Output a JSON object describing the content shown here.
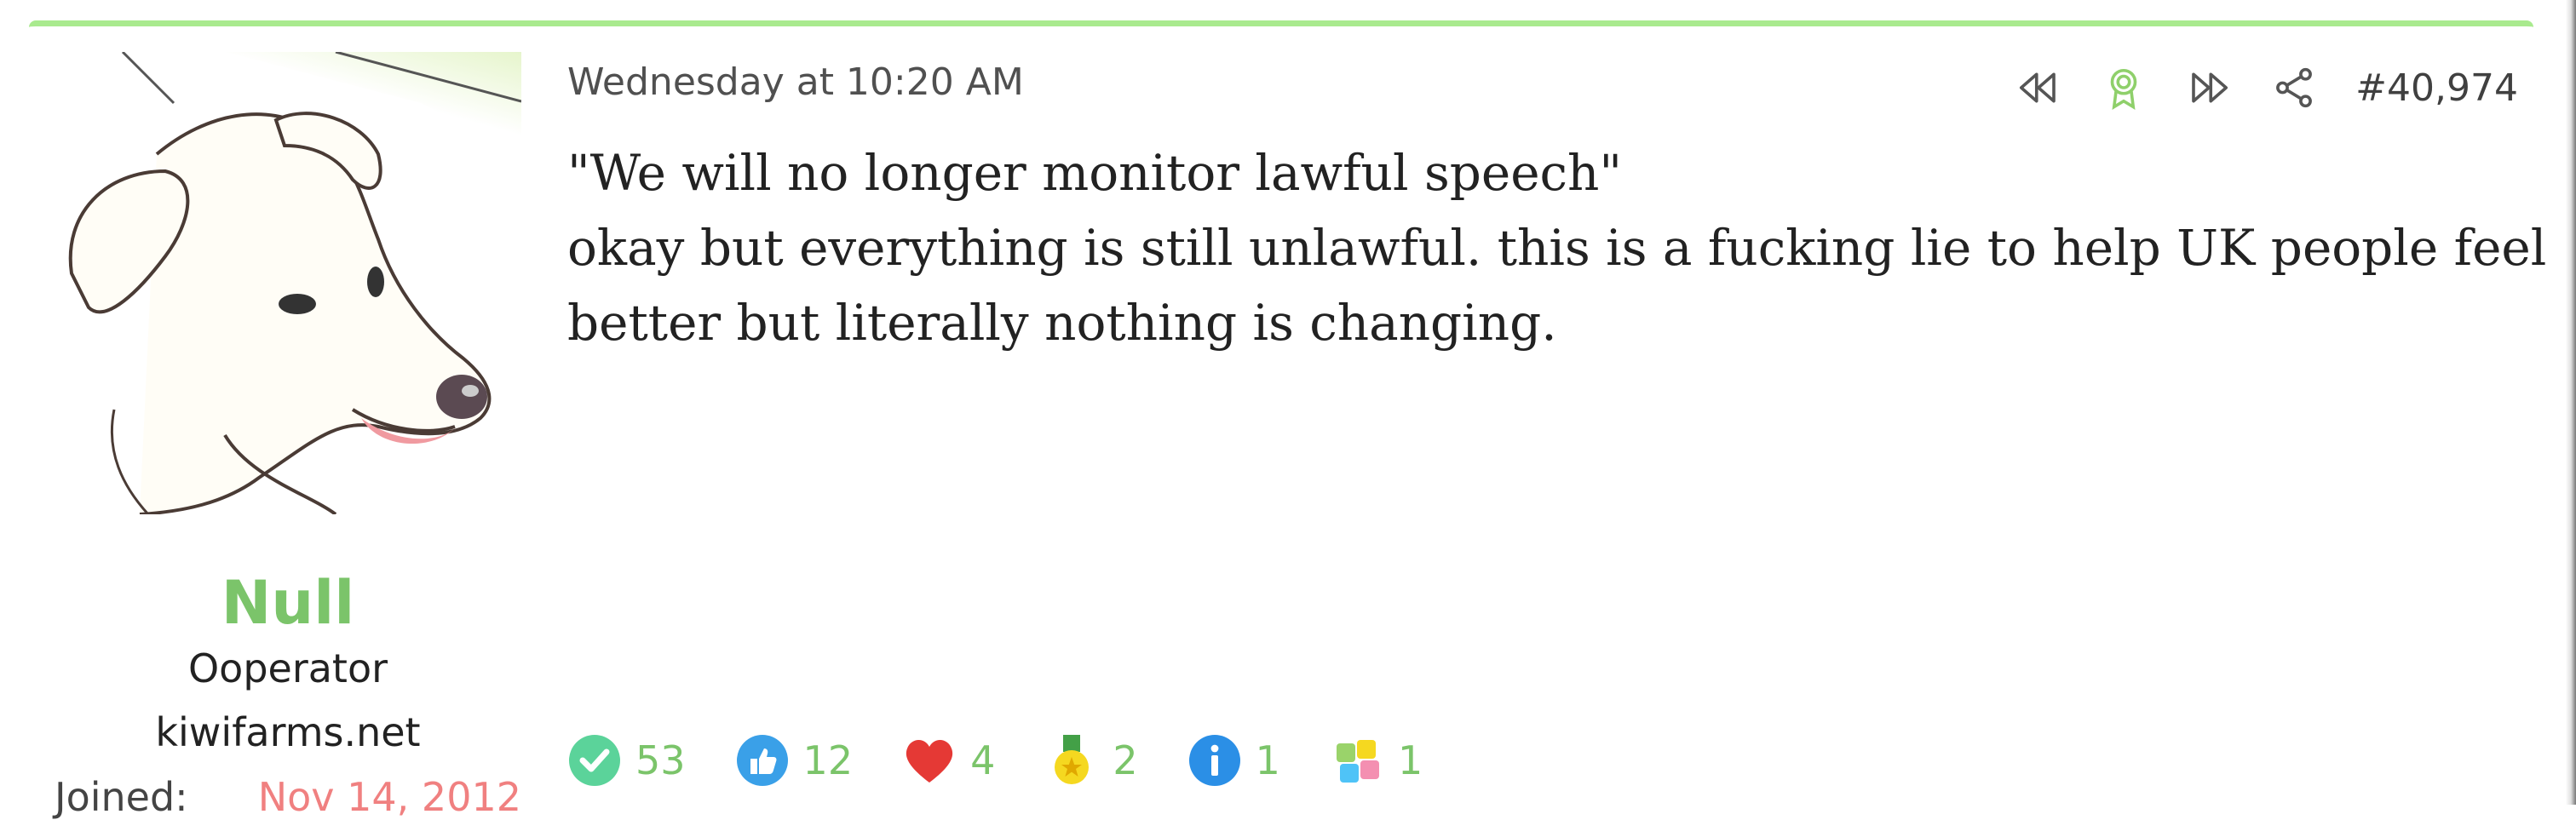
{
  "post": {
    "timestamp": "Wednesday at 10:20 AM",
    "number": "#40,974",
    "body": [
      "\"We will no longer monitor lawful speech\"",
      "okay but everything is still unlawful. this is a fucking lie to help UK people feel",
      "better but literally nothing is changing."
    ],
    "actions": [
      "rewind-icon",
      "award-icon",
      "fast-forward-icon",
      "share-icon"
    ]
  },
  "user": {
    "name": "Null",
    "title": "Ooperator",
    "site": "kiwifarms.net",
    "joined_label": "Joined:",
    "joined_date": "Nov 14, 2012",
    "avatar": "dog-avatar"
  },
  "reactions": [
    {
      "icon": "check-icon",
      "count": "53",
      "color": "#5bd39a"
    },
    {
      "icon": "thumbs-up-icon",
      "count": "12",
      "color": "#3aa0e8"
    },
    {
      "icon": "heart-icon",
      "count": "4",
      "color": "#e53935"
    },
    {
      "icon": "medal-icon",
      "count": "2",
      "color": "#f5d820"
    },
    {
      "icon": "info-icon",
      "count": "1",
      "color": "#2b8fe6"
    },
    {
      "icon": "puzzle-icon",
      "count": "1",
      "color": "#9ad36a"
    }
  ],
  "colors": {
    "accent": "#a9ea8e",
    "username": "#7bc46a",
    "joined_date": "#f08080"
  }
}
